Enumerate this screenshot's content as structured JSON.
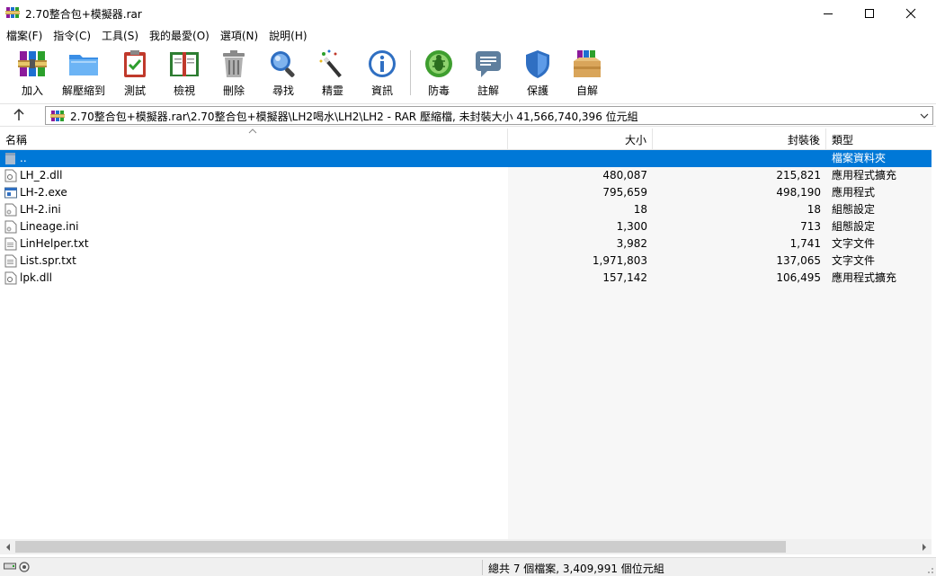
{
  "window": {
    "title": "2.70整合包+模擬器.rar",
    "icon": "winrar-books-icon"
  },
  "menu": [
    {
      "label": "檔案(F)"
    },
    {
      "label": "指令(C)"
    },
    {
      "label": "工具(S)"
    },
    {
      "label": "我的最愛(O)"
    },
    {
      "label": "選項(N)"
    },
    {
      "label": "說明(H)"
    }
  ],
  "toolbar": [
    {
      "label": "加入",
      "icon": "add-archive-icon"
    },
    {
      "label": "解壓縮到",
      "icon": "extract-to-folder-icon"
    },
    {
      "label": "測試",
      "icon": "test-clipboard-icon"
    },
    {
      "label": "檢視",
      "icon": "view-book-icon"
    },
    {
      "label": "刪除",
      "icon": "delete-trash-icon"
    },
    {
      "label": "尋找",
      "icon": "find-magnifier-icon"
    },
    {
      "label": "精靈",
      "icon": "wizard-wand-icon"
    },
    {
      "label": "資訊",
      "icon": "info-icon"
    },
    {
      "label": "防毒",
      "icon": "antivirus-bug-icon"
    },
    {
      "label": "註解",
      "icon": "comment-icon"
    },
    {
      "label": "保護",
      "icon": "protect-shield-icon"
    },
    {
      "label": "自解",
      "icon": "sfx-box-icon"
    }
  ],
  "address": {
    "path": "2.70整合包+模擬器.rar\\2.70整合包+模擬器\\LH2喝水\\LH2\\LH2 - RAR 壓縮檔, 未封裝大小 41,566,740,396 位元組"
  },
  "columns": {
    "name": "名稱",
    "size": "大小",
    "packed": "封裝後",
    "type": "類型"
  },
  "files": [
    {
      "name": "..",
      "size": "",
      "packed": "",
      "type": "檔案資料夾",
      "icon": "folder-up-icon",
      "selected": true
    },
    {
      "name": "LH_2.dll",
      "size": "480,087",
      "packed": "215,821",
      "type": "應用程式擴充",
      "icon": "dll-file-icon"
    },
    {
      "name": "LH-2.exe",
      "size": "795,659",
      "packed": "498,190",
      "type": "應用程式",
      "icon": "exe-file-icon"
    },
    {
      "name": "LH-2.ini",
      "size": "18",
      "packed": "18",
      "type": "組態設定",
      "icon": "ini-file-icon"
    },
    {
      "name": "Lineage.ini",
      "size": "1,300",
      "packed": "713",
      "type": "組態設定",
      "icon": "ini-file-icon"
    },
    {
      "name": "LinHelper.txt",
      "size": "3,982",
      "packed": "1,741",
      "type": "文字文件",
      "icon": "text-file-icon"
    },
    {
      "name": "List.spr.txt",
      "size": "1,971,803",
      "packed": "137,065",
      "type": "文字文件",
      "icon": "text-file-icon"
    },
    {
      "name": "lpk.dll",
      "size": "157,142",
      "packed": "106,495",
      "type": "應用程式擴充",
      "icon": "dll-file-icon"
    }
  ],
  "status": {
    "summary": "總共 7 個檔案, 3,409,991 個位元組"
  }
}
